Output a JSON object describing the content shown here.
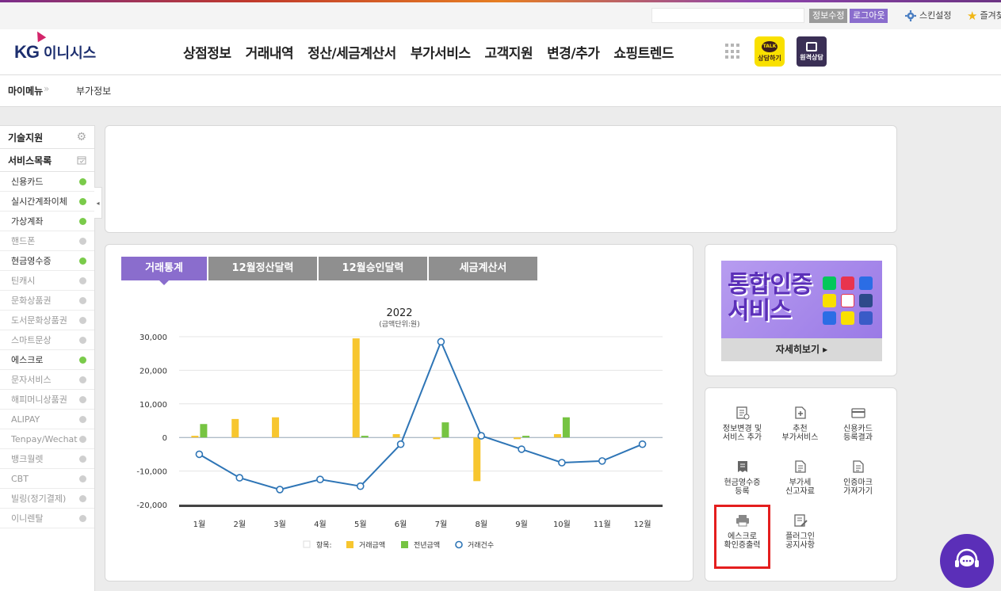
{
  "util": {
    "search_value": "",
    "edit_info_label": "정보수정",
    "logout_label": "로그아웃",
    "skin_label": "스킨설정",
    "favorites_label": "즐겨찾"
  },
  "header": {
    "logo_kg": "KG",
    "logo_name": "이니시스",
    "menu": [
      "상점정보",
      "거래내역",
      "정산/세금계산서",
      "부가서비스",
      "고객지원",
      "변경/추가",
      "쇼핑트렌드"
    ],
    "talk_badge": "TALK",
    "talk_label": "상담하기",
    "remote_label": "원격상담"
  },
  "breadcrumb": {
    "root": "마이메뉴",
    "current": "부가정보"
  },
  "sidebar": {
    "tech_support": "기술지원",
    "service_list": "서비스목록",
    "items": [
      {
        "label": "신용카드",
        "active": true
      },
      {
        "label": "실시간계좌이체",
        "active": true
      },
      {
        "label": "가상계좌",
        "active": true
      },
      {
        "label": "핸드폰",
        "active": false
      },
      {
        "label": "현금영수증",
        "active": true
      },
      {
        "label": "틴캐시",
        "active": false
      },
      {
        "label": "문화상품권",
        "active": false
      },
      {
        "label": "도서문화상품권",
        "active": false
      },
      {
        "label": "스마트문상",
        "active": false
      },
      {
        "label": "에스크로",
        "active": true
      },
      {
        "label": "문자서비스",
        "active": false
      },
      {
        "label": "해피머니상품권",
        "active": false
      },
      {
        "label": "ALIPAY",
        "active": false
      },
      {
        "label": "Tenpay/Wechat",
        "active": false
      },
      {
        "label": "뱅크월렛",
        "active": false
      },
      {
        "label": "CBT",
        "active": false
      },
      {
        "label": "빌링(정기결제)",
        "active": false
      },
      {
        "label": "이니렌탈",
        "active": false
      }
    ],
    "colors": {
      "active": "#7acb4a",
      "inactive": "#cfcfcf"
    }
  },
  "tabs": [
    {
      "label": "거래통계",
      "active": true
    },
    {
      "label": "12월정산달력",
      "active": false
    },
    {
      "label": "12월승인달력",
      "active": false
    },
    {
      "label": "세금계산서",
      "active": false
    }
  ],
  "chart_data": {
    "type": "bar",
    "title": "2022",
    "subtitle": "(금액단위:원)",
    "categories": [
      "1월",
      "2월",
      "3월",
      "4월",
      "5월",
      "6월",
      "7월",
      "8월",
      "9월",
      "10월",
      "11월",
      "12월"
    ],
    "ylim": [
      -20000,
      30000
    ],
    "yticks": [
      30000,
      20000,
      10000,
      0,
      -10000,
      -20000
    ],
    "ytick_labels": [
      "30,000",
      "20,000",
      "10,000",
      "0",
      "-10,000",
      "-20,000"
    ],
    "grid": true,
    "legend_position": "bottom",
    "legend_prefix": "항목:",
    "series": [
      {
        "name": "거래금액",
        "type": "bar",
        "color": "#f7c62f",
        "values": [
          500,
          5500,
          6000,
          0,
          29500,
          1000,
          -500,
          -13000,
          -500,
          1000,
          0,
          0
        ]
      },
      {
        "name": "전년금액",
        "type": "bar",
        "color": "#76c442",
        "values": [
          4000,
          0,
          0,
          0,
          500,
          0,
          4500,
          0,
          500,
          6000,
          0,
          0
        ]
      },
      {
        "name": "거래건수",
        "type": "line",
        "color": "#2e75b6",
        "values": [
          -5000,
          -12000,
          -15500,
          -12500,
          -14500,
          -2000,
          28500,
          500,
          -3500,
          -7500,
          -7000,
          -2000
        ]
      }
    ]
  },
  "banner": {
    "title": "통합인증\n서비스",
    "more_label": "자세히보기 ▸"
  },
  "quick_menu": [
    {
      "icon": "list-settings-icon",
      "line1": "정보변경 및",
      "line2": "서비스 추가"
    },
    {
      "icon": "doc-add-icon",
      "line1": "추천",
      "line2": "부가서비스"
    },
    {
      "icon": "card-icon",
      "line1": "신용카드",
      "line2": "등록결과"
    },
    {
      "icon": "receipt-icon",
      "line1": "현금영수증",
      "line2": "등록"
    },
    {
      "icon": "document-icon",
      "line1": "부가세",
      "line2": "신고자료"
    },
    {
      "icon": "document-icon",
      "line1": "인증마크",
      "line2": "가져가기"
    },
    {
      "icon": "printer-icon",
      "line1": "에스크로",
      "line2": "확인증출력"
    },
    {
      "icon": "edit-doc-icon",
      "line1": "플러그인",
      "line2": "공지사항"
    }
  ]
}
